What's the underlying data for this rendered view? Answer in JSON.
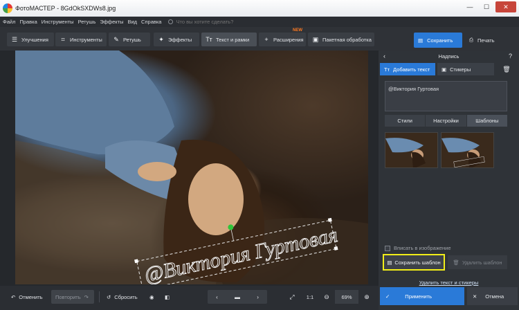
{
  "window": {
    "title": "ФотоМАСТЕР - 8GdOkSXDWs8.jpg"
  },
  "menu": {
    "items": [
      "Файл",
      "Правка",
      "Инструменты",
      "Ретушь",
      "Эффекты",
      "Вид",
      "Справка"
    ],
    "search_placeholder": "Что вы хотите сделать?"
  },
  "toolbar": {
    "tools": [
      {
        "label": "Улучшения",
        "icon": "sliders-icon"
      },
      {
        "label": "Инструменты",
        "icon": "crop-icon"
      },
      {
        "label": "Ретушь",
        "icon": "brush-icon"
      },
      {
        "label": "Эффекты",
        "icon": "magic-wand-icon"
      },
      {
        "label": "Текст и рамки",
        "icon": "text-icon"
      },
      {
        "label": "Расширения",
        "icon": "plus-icon",
        "badge": "NEW"
      },
      {
        "label": "Пакетная обработка",
        "icon": "batch-icon"
      }
    ],
    "save_label": "Сохранить",
    "print_label": "Печать"
  },
  "canvas": {
    "watermark_text": "@Виктория Гуртовая"
  },
  "panel": {
    "title": "Надпись",
    "tab_add_text": "Добавить текст",
    "tab_stickers": "Стикеры",
    "text_value": "@Виктория Гуртовая",
    "subtabs": [
      "Стили",
      "Настройки",
      "Шаблоны"
    ],
    "fit_label": "Вписать в изображение",
    "save_template_label": "Сохранить шаблон",
    "delete_template_label": "Удалить шаблон",
    "delete_link_label": "Удалить текст и стикеры",
    "apply_label": "Применить",
    "cancel_label": "Отмена"
  },
  "bottombar": {
    "undo_label": "Отменить",
    "redo_label": "Повторить",
    "reset_label": "Сбросить",
    "ratio_label": "1:1",
    "zoom_value": "69%"
  },
  "colors": {
    "accent": "#2a7ad8",
    "highlight": "#f2ee18",
    "new_badge": "#ff7a21"
  }
}
